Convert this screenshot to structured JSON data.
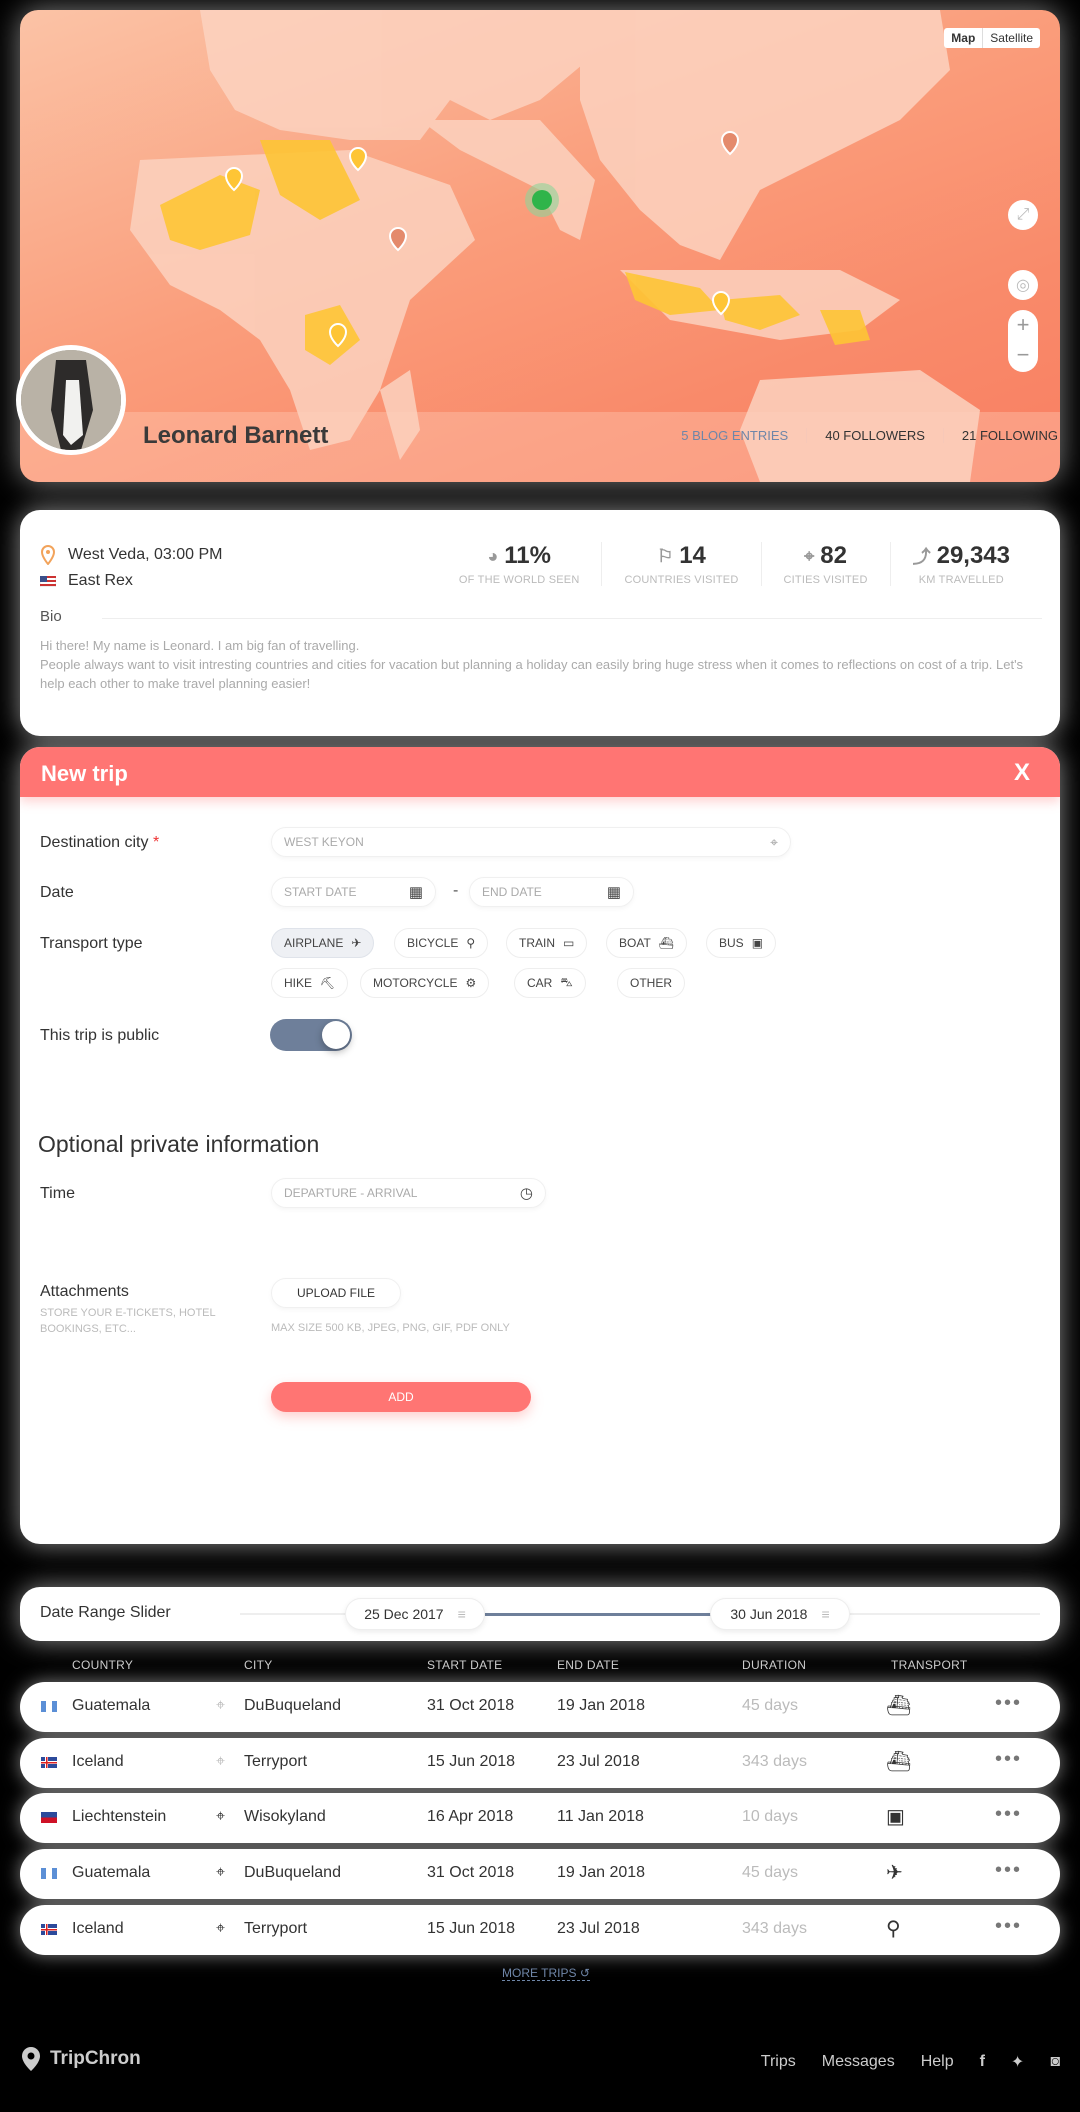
{
  "map": {
    "type_map": "Map",
    "type_satellite": "Satellite",
    "fullscreen_icon": "expand-icon",
    "locate_icon": "crosshair-icon",
    "zoom_in": "+",
    "zoom_out": "−"
  },
  "profile": {
    "name": "Leonard Barnett",
    "blog_entries": "5 BLOG ENTRIES",
    "followers": "40 FOLLOWERS",
    "following": "21 FOLLOWING"
  },
  "info": {
    "location": "West Veda, 03:00 PM",
    "country": "East Rex",
    "stats": [
      {
        "value": "11%",
        "label": "OF THE WORLD SEEN",
        "icon": "globe-icon"
      },
      {
        "value": "14",
        "label": "COUNTRIES VISITED",
        "icon": "flag-icon"
      },
      {
        "value": "82",
        "label": "CITIES VISITED",
        "icon": "pin-icon"
      },
      {
        "value": "29,343",
        "label": "KM TRAVELLED",
        "icon": "route-icon"
      }
    ],
    "bio_title": "Bio",
    "bio_line1": "Hi there! My name is Leonard. I am big fan of travelling.",
    "bio_line2": "People always want to visit intresting countries and cities for vacation but planning a holiday can easily bring huge stress when it comes to reflections on cost of a trip. Let's help each other to make travel planning easier!"
  },
  "new_trip": {
    "title": "New trip",
    "close": "X",
    "destination_label": "Destination city",
    "required": "*",
    "destination_placeholder": "WEST KEYON",
    "date_label": "Date",
    "start_placeholder": "START DATE",
    "end_placeholder": "END DATE",
    "dash": "-",
    "transport_label": "Transport type",
    "transport": [
      "AIRPLANE",
      "BICYCLE",
      "TRAIN",
      "BOAT",
      "BUS",
      "HIKE",
      "MOTORCYCLE",
      "CAR",
      "OTHER"
    ],
    "public_label": "This trip is public",
    "optional_title": "Optional private information",
    "time_label": "Time",
    "time_placeholder": "DEPARTURE - ARRIVAL",
    "attachments_label": "Attachments",
    "attachments_hint": "STORE YOUR E-TICKETS, HOTEL BOOKINGS, ETC...",
    "upload": "UPLOAD FILE",
    "upload_hint": "MAX SIZE 500 KB, JPEG, PNG, GIF, PDF ONLY",
    "add": "ADD"
  },
  "slider": {
    "label": "Date Range Slider",
    "start": "25 Dec 2017",
    "end": "30 Jun 2018"
  },
  "table": {
    "headers": [
      "COUNTRY",
      "CITY",
      "START DATE",
      "END DATE",
      "DURATION",
      "TRANSPORT"
    ],
    "rows": [
      {
        "country": "Guatemala",
        "city": "DuBuqueland",
        "start": "31 Oct 2018",
        "end": "19 Jan 2018",
        "duration": "45 days",
        "transport": "boat-icon"
      },
      {
        "country": "Iceland",
        "city": "Terryport",
        "start": "15 Jun 2018",
        "end": "23 Jul 2018",
        "duration": "343 days",
        "transport": "ship-icon"
      },
      {
        "country": "Liechtenstein",
        "city": "Wisokyland",
        "start": "16 Apr 2018",
        "end": "11 Jan 2018",
        "duration": "10 days",
        "transport": "bus-icon"
      },
      {
        "country": "Guatemala",
        "city": "DuBuqueland",
        "start": "31 Oct 2018",
        "end": "19 Jan 2018",
        "duration": "45 days",
        "transport": "airplane-icon"
      },
      {
        "country": "Iceland",
        "city": "Terryport",
        "start": "15 Jun 2018",
        "end": "23 Jul 2018",
        "duration": "343 days",
        "transport": "bicycle-icon"
      }
    ],
    "more": "MORE TRIPS"
  },
  "footer": {
    "brand": "TripChron",
    "nav": [
      "Trips",
      "Messages",
      "Help"
    ]
  },
  "colors": {
    "accent": "#ff7573",
    "slate": "#6e7f9a",
    "highlight": "#fbc02d"
  }
}
